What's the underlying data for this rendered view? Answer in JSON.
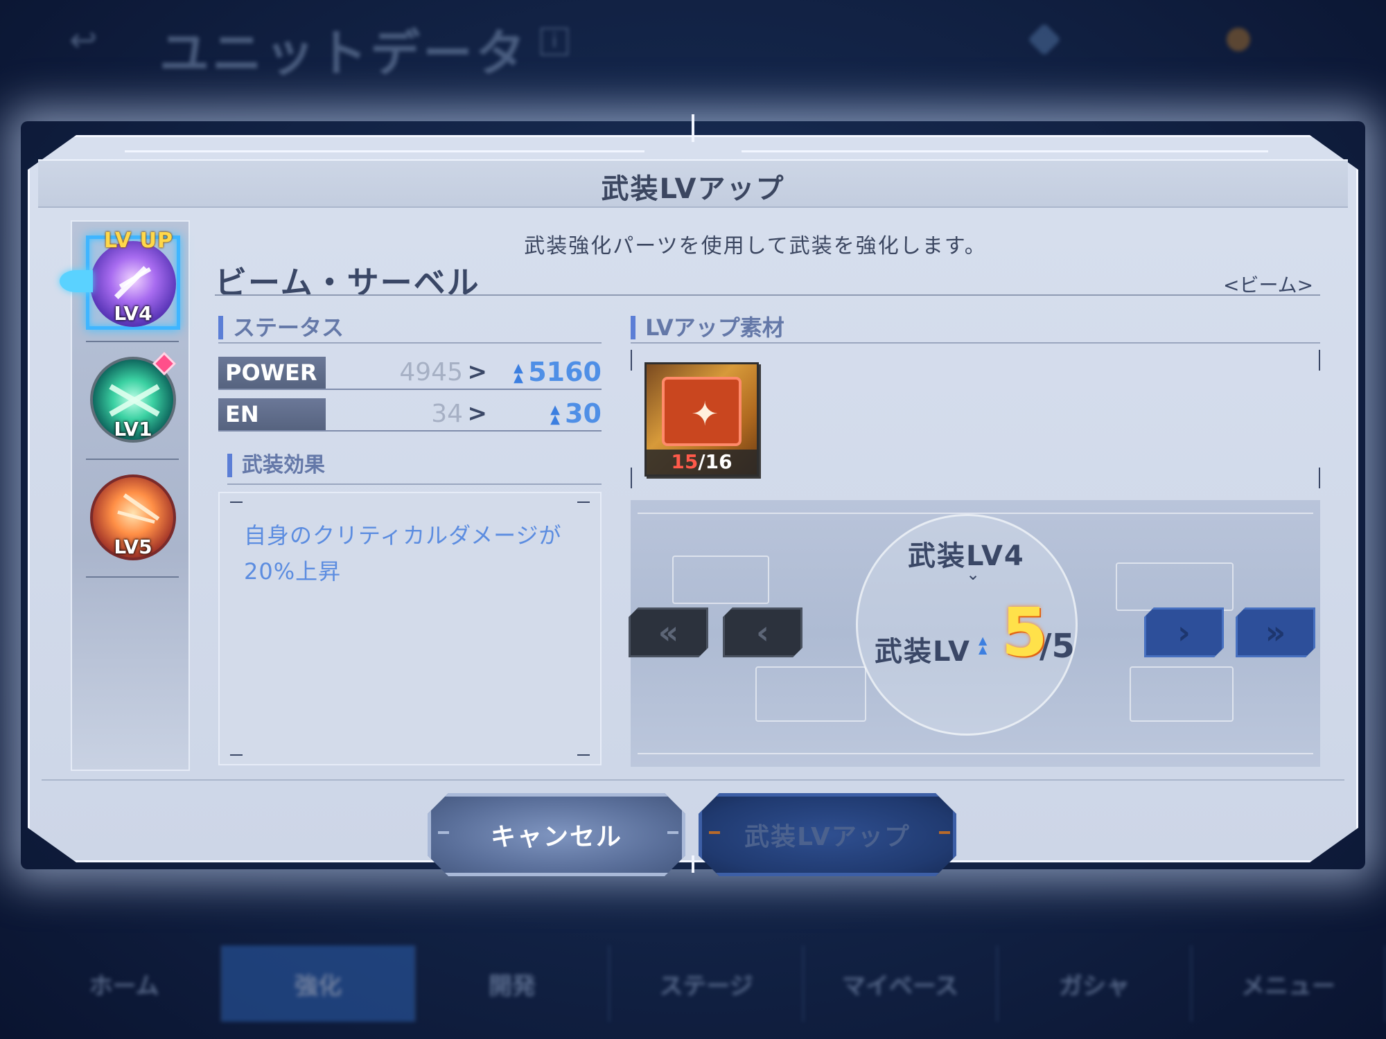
{
  "background": {
    "screen_title": "ユニットデータ",
    "nav": [
      "ホーム",
      "強化",
      "開発",
      "ステージ",
      "マイベース",
      "ガシャ",
      "メニュー"
    ]
  },
  "dialog": {
    "title": "武装LVアップ",
    "description": "武装強化パーツを使用して武装を強化します。"
  },
  "sidebar": {
    "lvup_badge": "LV UP",
    "weapons": [
      {
        "level": "LV4",
        "icon": "beam-burst-icon",
        "color": "#a86cf0",
        "selected": true
      },
      {
        "level": "LV1",
        "icon": "green-cross-blast-icon",
        "color": "#3bd1a2",
        "new": true
      },
      {
        "level": "LV5",
        "icon": "orange-burst-icon",
        "color": "#ff8f46"
      }
    ]
  },
  "weapon": {
    "name": "ビーム・サーベル",
    "type": "<ビーム>"
  },
  "status": {
    "heading": "ステータス",
    "rows": [
      {
        "label": "POWER",
        "old": "4945",
        "arrow": ">",
        "new": "5160"
      },
      {
        "label": "EN",
        "old": "34",
        "arrow": ">",
        "new": "30"
      }
    ]
  },
  "effect": {
    "heading": "武装効果",
    "text": "自身のクリティカルダメージが20%上昇"
  },
  "materials": {
    "heading": "LVアップ素材",
    "items": [
      {
        "icon": "upgrade-part-icon",
        "have": "15",
        "need": "/16"
      }
    ]
  },
  "level_selector": {
    "current_label": "武装LV4",
    "new_label": "武装LV",
    "new_value": "5",
    "max": "/5",
    "buttons": {
      "min": "«",
      "prev": "‹",
      "next": "›",
      "max": "»"
    }
  },
  "buttons": {
    "cancel": "キャンセル",
    "confirm": "武装LVアップ"
  },
  "colors": {
    "accent_blue": "#4f8fe6",
    "level_highlight": "#ffe14a",
    "material_shortage": "#ff5a4a"
  }
}
